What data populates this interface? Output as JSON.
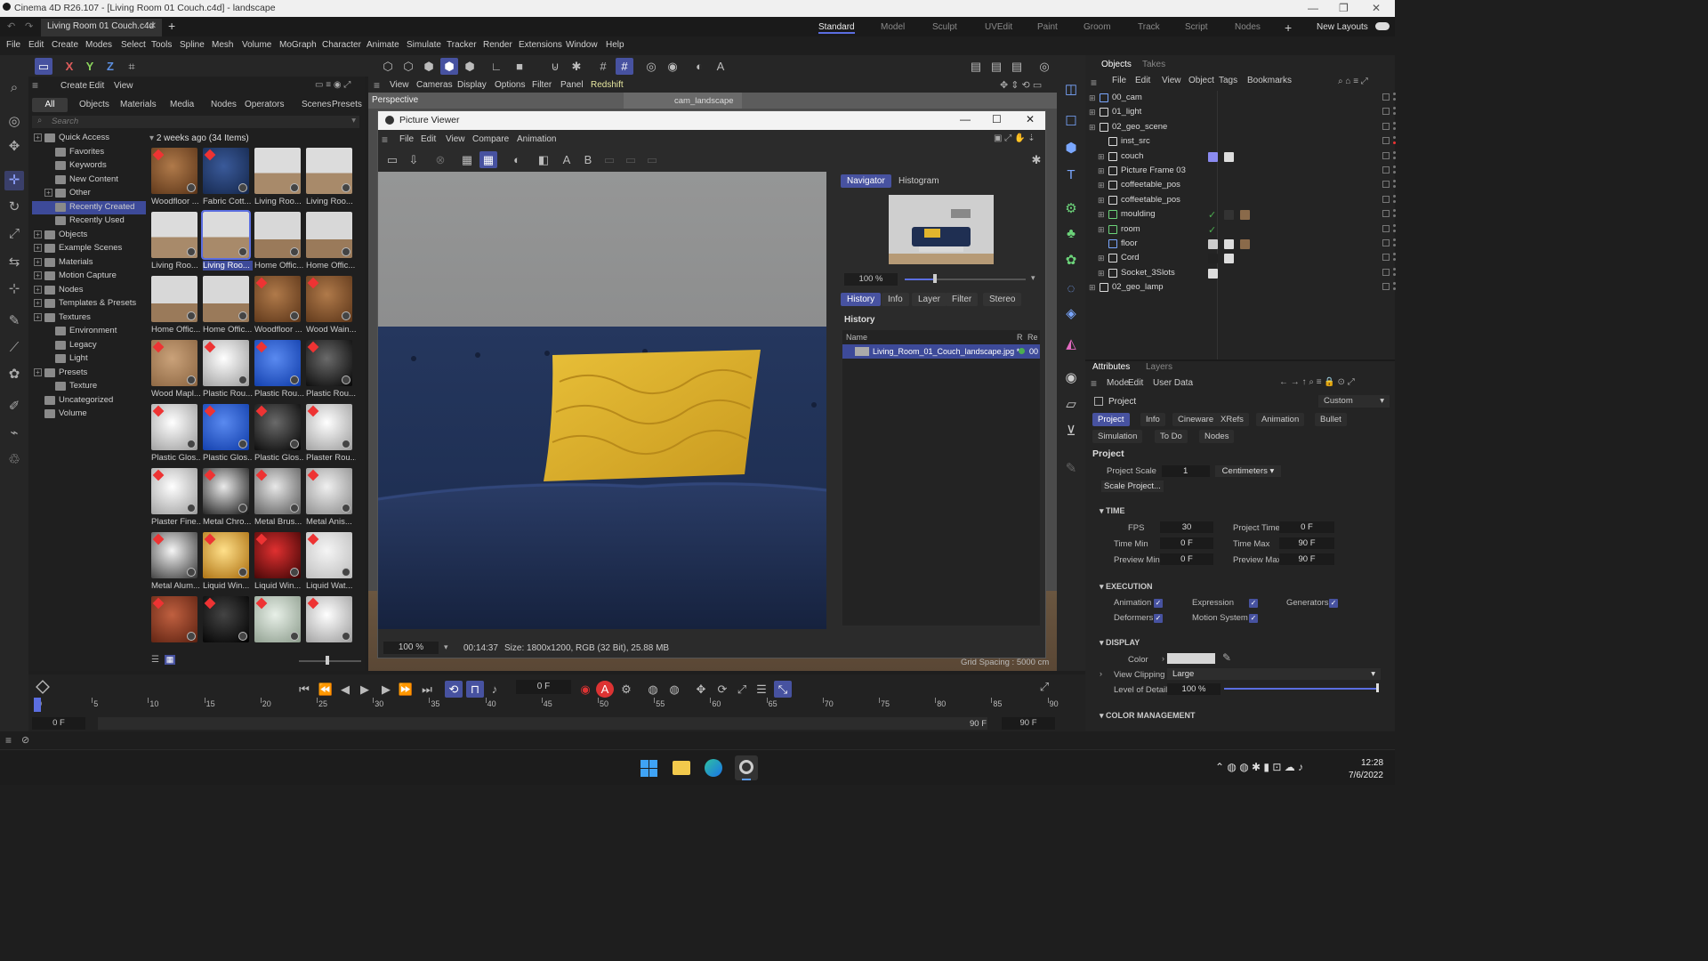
{
  "window": {
    "title": "Cinema 4D R26.107 - [Living Room 01 Couch.c4d] - landscape",
    "doc_tab": "Living Room 01 Couch.c4d"
  },
  "workspaces": [
    "Standard",
    "Model",
    "Sculpt",
    "UVEdit",
    "Paint",
    "Groom",
    "Track",
    "Script",
    "Nodes"
  ],
  "workspace_active": "Standard",
  "new_layouts": "New Layouts",
  "menu": [
    "File",
    "Edit",
    "Create",
    "Modes",
    "Select",
    "Tools",
    "Spline",
    "Mesh",
    "Volume",
    "MoGraph",
    "Character",
    "Animate",
    "Simulate",
    "Tracker",
    "Render",
    "Extensions",
    "Window",
    "Help"
  ],
  "axis_buttons": [
    "X",
    "Y",
    "Z"
  ],
  "assets": {
    "menu": [
      "Create",
      "Edit",
      "View"
    ],
    "tabs": [
      "All",
      "Objects",
      "Materials",
      "Media",
      "Nodes",
      "Operators",
      "Scenes",
      "Presets"
    ],
    "active_tab": "All",
    "search_placeholder": "Search",
    "tree": [
      "Quick Access",
      "Favorites",
      "Keywords",
      "New Content",
      "Other",
      "Recently Created",
      "Recently Used",
      "Objects",
      "Example Scenes",
      "Materials",
      "Motion Capture",
      "Nodes",
      "Templates & Presets",
      "Textures",
      "Environment",
      "Legacy",
      "Light",
      "Presets",
      "Texture",
      "Uncategorized",
      "Volume"
    ],
    "tree_selected": "Recently Created",
    "grid_header": "2 weeks ago (34 Items)",
    "items": [
      "Woodfloor ...",
      "Fabric Cott...",
      "Living Roo...",
      "Living Roo...",
      "Living Roo...",
      "Living Roo...",
      "Home Offic...",
      "Home Offic...",
      "Home Offic...",
      "Home Offic...",
      "Woodfloor ...",
      "Wood Wain...",
      "Wood Mapl...",
      "Plastic Rou...",
      "Plastic Rou...",
      "Plastic Rou...",
      "Plastic Glos...",
      "Plastic Glos...",
      "Plastic Glos...",
      "Plaster Rou...",
      "Plaster Fine...",
      "Metal Chro...",
      "Metal Brus...",
      "Metal Anis...",
      "Metal Alum...",
      "Liquid Win...",
      "Liquid Win...",
      "Liquid Wat...",
      "",
      "",
      "",
      ""
    ],
    "item_selected": "Living Roo..."
  },
  "viewport": {
    "menu": [
      "View",
      "Cameras",
      "Display",
      "Options",
      "Filter",
      "Panel",
      "Redshift"
    ],
    "label": "Perspective",
    "camera": "cam_landscape",
    "grid_spacing": "Grid Spacing : 5000 cm"
  },
  "picture_viewer": {
    "title": "Picture Viewer",
    "menu": [
      "File",
      "Edit",
      "View",
      "Compare",
      "Animation"
    ],
    "nav_tabs": [
      "Navigator",
      "Histogram"
    ],
    "nav_zoom": "100 %",
    "tabs": [
      "History",
      "Info",
      "Layer",
      "Filter",
      "Stereo"
    ],
    "history_label": "History",
    "col_name": "Name",
    "col_r": "R",
    "col_re": "Re",
    "history_item": "Living_Room_01_Couch_landscape.jpg *",
    "history_re": "00",
    "status_zoom": "100 %",
    "status_time": "00:14:37",
    "status_size": "Size: 1800x1200, RGB (32 Bit), 25.88 MB"
  },
  "timeline": {
    "frame": "0 F",
    "ticks": [
      "0",
      "5",
      "10",
      "15",
      "20",
      "25",
      "30",
      "35",
      "40",
      "45",
      "50",
      "55",
      "60",
      "65",
      "70",
      "75",
      "80",
      "85",
      "90"
    ],
    "start": "0 F",
    "start2": "0 F",
    "end": "90 F",
    "end2": "90 F"
  },
  "objects": {
    "tabs": [
      "Objects",
      "Takes"
    ],
    "menu": [
      "File",
      "Edit",
      "View",
      "Object",
      "Tags",
      "Bookmarks"
    ],
    "rows": [
      "00_cam",
      "01_light",
      "02_geo_scene",
      "inst_src",
      "couch",
      "Picture Frame 03",
      "coffeetable_pos",
      "coffeetable_pos",
      "moulding",
      "room",
      "floor",
      "Cord",
      "Socket_3Slots",
      "02_geo_lamp"
    ]
  },
  "attributes": {
    "tabs": [
      "Attributes",
      "Layers"
    ],
    "menu": [
      "Mode",
      "Edit",
      "User Data"
    ],
    "header": "Project",
    "preset": "Custom",
    "pills_row1": [
      "Project",
      "Info",
      "Cineware",
      "XRefs",
      "Animation",
      "Bullet"
    ],
    "pills_row2": [
      "Simulation",
      "To Do",
      "Nodes"
    ],
    "section_title": "Project",
    "project_scale_label": "Project Scale",
    "project_scale": "1",
    "units": "Centimeters",
    "scale_btn": "Scale Project...",
    "time_hdr": "TIME",
    "fps_label": "FPS",
    "fps": "30",
    "ptime_label": "Project Time",
    "ptime": "0 F",
    "tmin_label": "Time Min",
    "tmin": "0 F",
    "tmax_label": "Time Max",
    "tmax": "90 F",
    "pmin_label": "Preview Min",
    "pmin": "0 F",
    "pmax_label": "Preview Max",
    "pmax": "90 F",
    "exec_hdr": "EXECUTION",
    "anim_label": "Animation",
    "expr_label": "Expression",
    "gen_label": "Generators",
    "deform_label": "Deformers",
    "motion_label": "Motion System",
    "display_hdr": "DISPLAY",
    "color_label": "Color",
    "clip_label": "View Clipping",
    "clip": "Large",
    "lod_label": "Level of Detail",
    "lod": "100 %",
    "cm_hdr": "COLOR MANAGEMENT"
  },
  "taskbar": {
    "time": "12:28",
    "date": "7/6/2022"
  },
  "colors": {
    "accent": "#4752a0",
    "accent_light": "#5b6ee1",
    "sofa": "#1f2f52",
    "pillow": "#e2b52d"
  }
}
